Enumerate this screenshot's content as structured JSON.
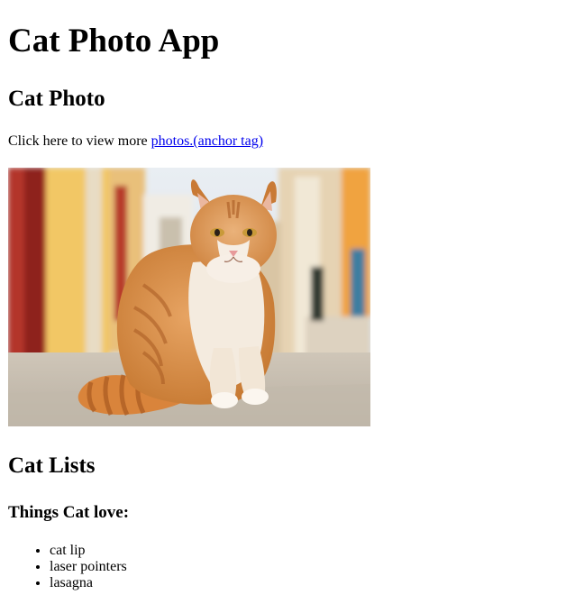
{
  "page": {
    "title": "Cat Photo App",
    "photo_heading": "Cat Photo",
    "intro_text": "Click here to view more ",
    "intro_link": "photos.(anchor tag)",
    "photo_alt": "A cute orange cat sitting in a street",
    "lists_heading": "Cat Lists",
    "love_heading": "Things Cat love:",
    "love_items": [
      "cat lip",
      "laser pointers",
      "lasagna"
    ]
  },
  "colors": {
    "link": "#0000ee",
    "text": "#000000",
    "background": "#ffffff"
  }
}
